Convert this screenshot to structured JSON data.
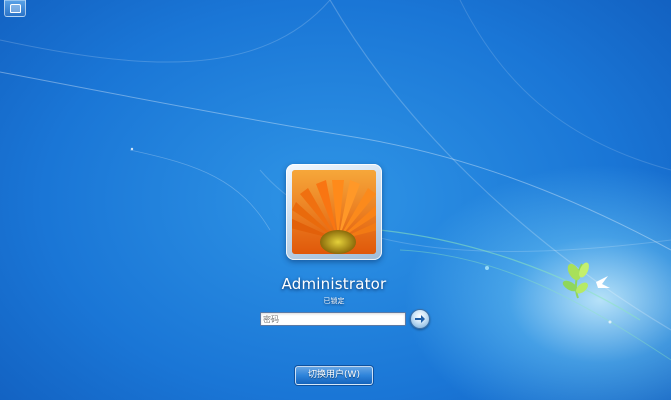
{
  "user": {
    "name": "Administrator",
    "status": "已锁定"
  },
  "password": {
    "placeholder": "密码",
    "value": ""
  },
  "buttons": {
    "switch_user": "切换用户(W)"
  },
  "icons": {
    "ease_of_access": "ease-of-access-icon",
    "submit": "arrow-right-icon",
    "logo": "bird-leaf-icon"
  },
  "colors": {
    "background": "#1a76d6",
    "accent_glow": "#d2f5ff",
    "flower": "#f47a10"
  }
}
